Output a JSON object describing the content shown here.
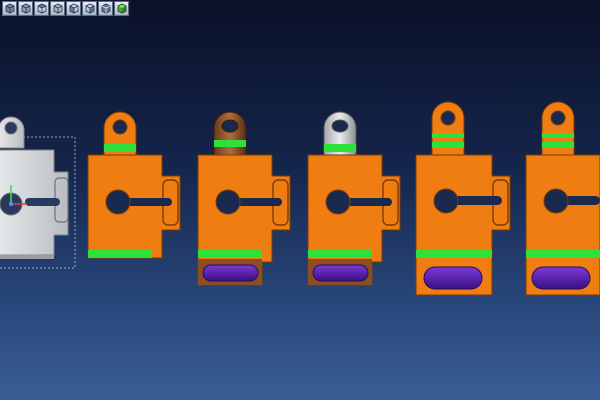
{
  "app": {
    "title": ""
  },
  "toolbar": {
    "buttons": [
      {
        "icon": "view-front-cube-icon"
      },
      {
        "icon": "view-back-cube-icon"
      },
      {
        "icon": "view-top-cube-icon"
      },
      {
        "icon": "view-bottom-cube-icon"
      },
      {
        "icon": "view-left-cube-icon"
      },
      {
        "icon": "view-right-cube-icon"
      },
      {
        "icon": "view-iso-cube-icon"
      },
      {
        "icon": "view-iso-green-cube-icon"
      }
    ]
  },
  "colors": {
    "part_orange": "#ef7d12",
    "band_green": "#2de03a",
    "slot_purple": "#5a1fb0",
    "selected_gray": "#cfd2d6",
    "bg_top": "#0a1128",
    "bg_bottom": "#3a5e94"
  },
  "parts": [
    {
      "name": "selected-part",
      "state": "selected"
    },
    {
      "name": "part-stage-1",
      "state": "stage-1"
    },
    {
      "name": "part-stage-2",
      "state": "stage-2"
    },
    {
      "name": "part-stage-3",
      "state": "stage-3"
    },
    {
      "name": "part-stage-4",
      "state": "stage-4"
    },
    {
      "name": "part-stage-5",
      "state": "stage-5"
    }
  ]
}
